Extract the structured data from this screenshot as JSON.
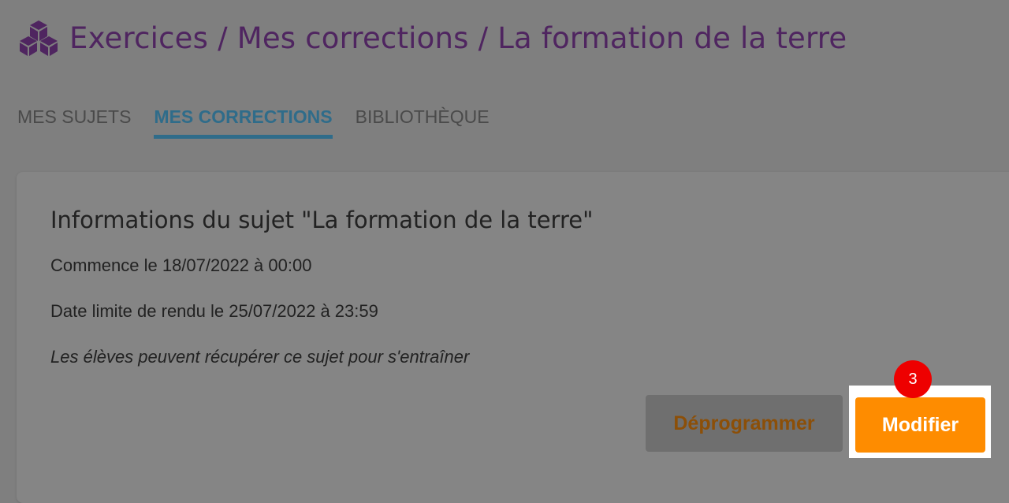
{
  "header": {
    "icon": "cubes-icon",
    "title": "Exercices / Mes corrections / La formation de la terre"
  },
  "tabs": [
    {
      "label": "MES SUJETS",
      "active": false
    },
    {
      "label": "MES CORRECTIONS",
      "active": true
    },
    {
      "label": "BIBLIOTHÈQUE",
      "active": false
    }
  ],
  "card": {
    "title": "Informations du sujet \"La formation de la terre\"",
    "start_line": "Commence le 18/07/2022 à 00:00",
    "deadline_line": "Date limite de rendu le  25/07/2022 à 23:59",
    "note_line": "Les élèves peuvent récupérer ce sujet pour s'entraîner"
  },
  "actions": {
    "deprogram_label": "Déprogrammer",
    "modify_label": "Modifier"
  },
  "step_badge": "3",
  "colors": {
    "overlay": "#7f7f7f",
    "title": "#4f2560",
    "tab_active": "#2f6c8a",
    "primary_button": "#fe8c00",
    "secondary_button_text": "#8c4f08",
    "badge": "#ee0000"
  }
}
